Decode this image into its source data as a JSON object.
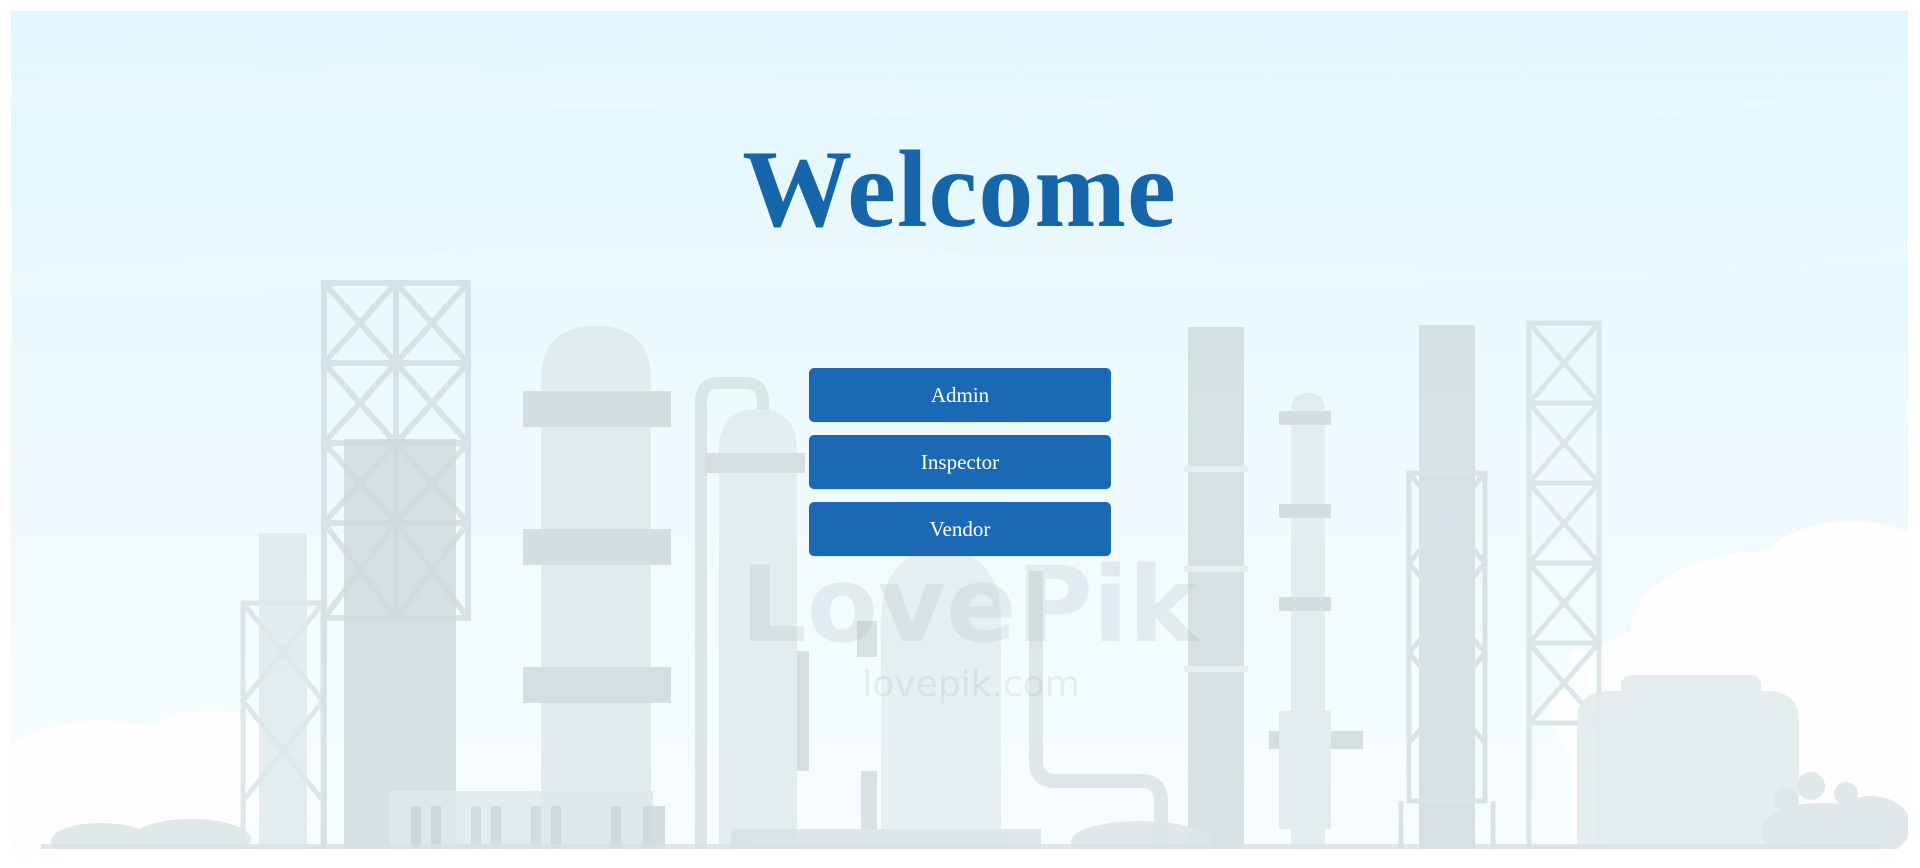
{
  "page": {
    "title": "Welcome",
    "accent_color": "#1565a8",
    "button_color": "#1b68b4"
  },
  "roles": {
    "admin_label": "Admin",
    "inspector_label": "Inspector",
    "vendor_label": "Vendor"
  },
  "background": {
    "watermark_logo": "LovePik",
    "watermark_url": "lovepik.com",
    "scene": "industrial-plant-illustration"
  }
}
